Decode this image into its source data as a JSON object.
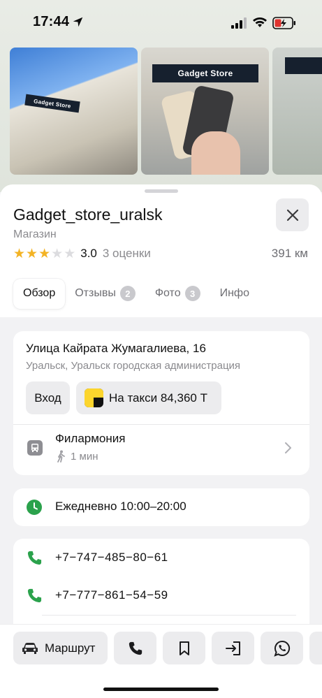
{
  "status_bar": {
    "time": "17:44"
  },
  "place": {
    "title": "Gadget_store_uralsk",
    "category": "Магазин",
    "rating_value": "3.0",
    "rating_stars": 3,
    "rating_count": "3 оценки",
    "distance": "391 км"
  },
  "gallery": {
    "sign_text": "Gadget Store"
  },
  "tabs": [
    {
      "label": "Обзор",
      "badge": ""
    },
    {
      "label": "Отзывы",
      "badge": "2"
    },
    {
      "label": "Фото",
      "badge": "3"
    },
    {
      "label": "Инфо",
      "badge": ""
    }
  ],
  "address": {
    "line1": "Улица Кайрата Жумагалиева, 16",
    "line2": "Уральск, Уральск городская администрация",
    "entrance_label": "Вход",
    "taxi_label": "На такси 84,360 Т"
  },
  "transit": {
    "stop_name": "Филармония",
    "walk_time": "1 мин"
  },
  "hours": {
    "text": "Ежедневно 10:00–20:00"
  },
  "phones": [
    "+7−747−485−80−61",
    "+7−777−861−54−59"
  ],
  "bottom_bar": {
    "route_label": "Маршрут"
  },
  "colors": {
    "star": "#f3b324",
    "green_icon": "#2ba24c",
    "taxi_yellow": "#fcd52d"
  }
}
